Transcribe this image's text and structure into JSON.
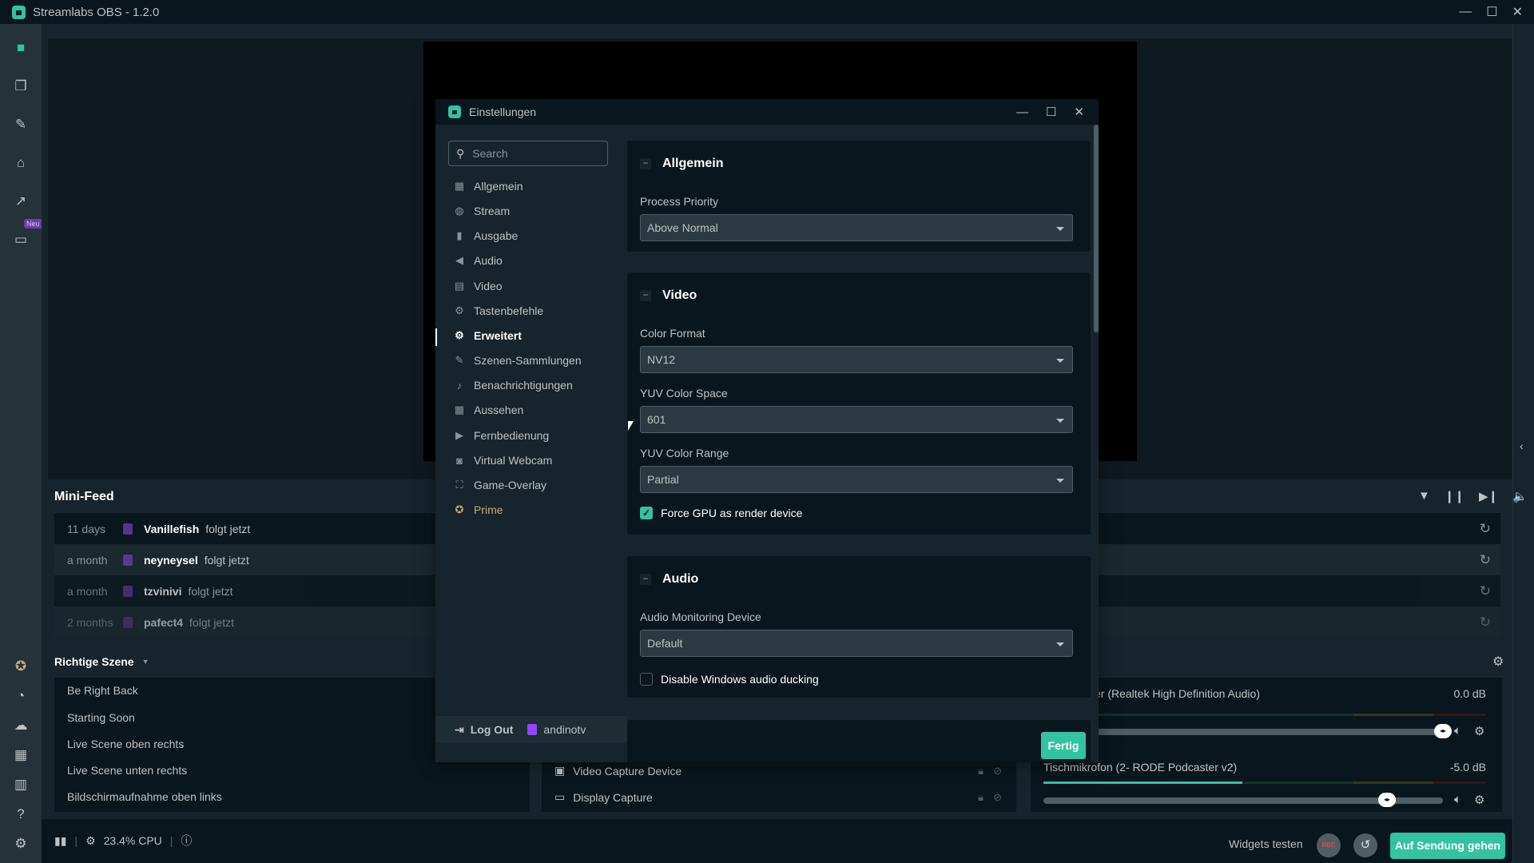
{
  "app": {
    "title": "Streamlabs OBS - 1.2.0",
    "window_controls": {
      "minimize": "—",
      "maximize": "☐",
      "close": "✕"
    }
  },
  "left_nav": {
    "top_items": [
      {
        "name": "editor",
        "icon": "camera-icon"
      },
      {
        "name": "themes",
        "icon": "layers-icon"
      },
      {
        "name": "app-store",
        "icon": "tools-icon"
      },
      {
        "name": "store",
        "icon": "store-icon"
      },
      {
        "name": "dashboard",
        "icon": "chart-icon"
      },
      {
        "name": "highlighter",
        "icon": "clapper-icon",
        "badge": "Neu"
      }
    ],
    "bottom_items": [
      {
        "name": "prime",
        "icon": "prime-icon"
      },
      {
        "name": "dashboard-link",
        "icon": "dashboard-icon"
      },
      {
        "name": "cloudbot",
        "icon": "chat-icon"
      },
      {
        "name": "layout",
        "icon": "grid-icon"
      },
      {
        "name": "studio-mode",
        "icon": "columns-icon"
      },
      {
        "name": "help",
        "icon": "help-icon"
      },
      {
        "name": "settings",
        "icon": "gear-icon"
      }
    ]
  },
  "minifeed": {
    "title": "Mini-Feed",
    "items": [
      {
        "time": "11 days",
        "user": "Vanillefish",
        "action": "folgt jetzt"
      },
      {
        "time": "a month",
        "user": "neyneysel",
        "action": "folgt jetzt"
      },
      {
        "time": "a month",
        "user": "tzvinivi",
        "action": "folgt jetzt"
      },
      {
        "time": "2 months",
        "user": "pafect4",
        "action": "folgt jetzt"
      }
    ]
  },
  "scenes": {
    "collection": "Richtige Szene",
    "items": [
      "Be Right Back",
      "Starting Soon",
      "Live Scene oben rechts",
      "Live Scene unten rechts",
      "Bildschirmaufnahme oben links"
    ]
  },
  "sources": {
    "items": [
      {
        "name": "Video Capture Device",
        "icon": "webcam-icon"
      },
      {
        "name": "Display Capture",
        "icon": "monitor-icon"
      }
    ]
  },
  "mixer": {
    "channels": [
      {
        "name": "er (Realtek High Definition Audio)",
        "db": "0.0 dB",
        "level": 0,
        "volume": 1.0
      },
      {
        "name": "Tischmikrofon (2- RODE Podcaster v2)",
        "db": "-5.0 dB",
        "level": 0.45,
        "volume": 0.86
      }
    ]
  },
  "footer": {
    "cpu": "23.4% CPU",
    "widgets_label": "Widgets testen",
    "rec_label": "REC",
    "go_live_label": "Auf Sendung gehen"
  },
  "settings": {
    "title": "Einstellungen",
    "search_placeholder": "Search",
    "nav": [
      {
        "label": "Allgemein",
        "icon": "grid-icon"
      },
      {
        "label": "Stream",
        "icon": "globe-icon"
      },
      {
        "label": "Ausgabe",
        "icon": "chip-icon"
      },
      {
        "label": "Audio",
        "icon": "speaker-icon"
      },
      {
        "label": "Video",
        "icon": "film-icon"
      },
      {
        "label": "Tastenbefehle",
        "icon": "gear-icon"
      },
      {
        "label": "Erweitert",
        "icon": "gears-icon",
        "active": true
      },
      {
        "label": "Szenen-Sammlungen",
        "icon": "tools-icon"
      },
      {
        "label": "Benachrichtigungen",
        "icon": "bell-icon"
      },
      {
        "label": "Aussehen",
        "icon": "apps-icon"
      },
      {
        "label": "Fernbedienung",
        "icon": "play-icon"
      },
      {
        "label": "Virtual Webcam",
        "icon": "camera-icon"
      },
      {
        "label": "Game-Overlay",
        "icon": "expand-icon"
      },
      {
        "label": "Prime",
        "icon": "prime-icon"
      }
    ],
    "logout_label": "Log Out",
    "account": "andinotv",
    "done_label": "Fertig",
    "sections": {
      "general": {
        "title": "Allgemein",
        "process_priority_label": "Process Priority",
        "process_priority_value": "Above Normal"
      },
      "video": {
        "title": "Video",
        "color_format_label": "Color Format",
        "color_format_value": "NV12",
        "yuv_space_label": "YUV Color Space",
        "yuv_space_value": "601",
        "yuv_range_label": "YUV Color Range",
        "yuv_range_value": "Partial",
        "force_gpu_label": "Force GPU as render device",
        "force_gpu_checked": true
      },
      "audio": {
        "title": "Audio",
        "monitoring_label": "Audio Monitoring Device",
        "monitoring_value": "Default",
        "ducking_label": "Disable Windows audio ducking",
        "ducking_checked": false
      }
    }
  },
  "colors": {
    "accent": "#31c3a2",
    "background": "#09161d",
    "panel": "#17242d",
    "twitch": "#9146ff",
    "prime": "#c9a978"
  }
}
